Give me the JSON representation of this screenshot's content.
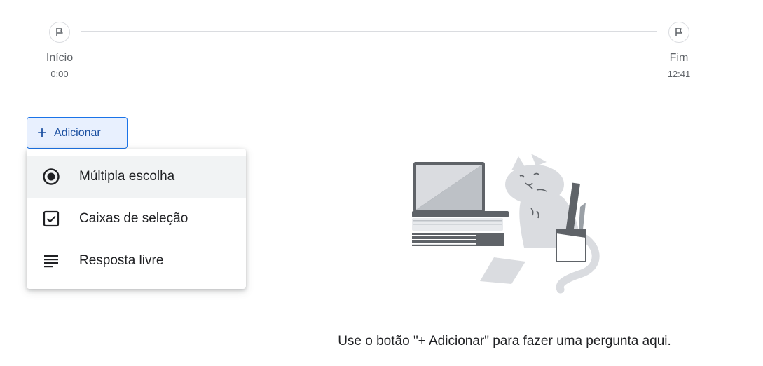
{
  "timeline": {
    "start_label": "Início",
    "start_time": "0:00",
    "end_label": "Fim",
    "end_time": "12:41"
  },
  "add_button": {
    "icon": "plus-icon",
    "label": "Adicionar"
  },
  "menu": {
    "items": [
      {
        "icon": "radio-button-checked-icon",
        "label": "Múltipla escolha"
      },
      {
        "icon": "checkbox-checked-icon",
        "label": "Caixas de seleção"
      },
      {
        "icon": "short-text-icon",
        "label": "Resposta livre"
      }
    ]
  },
  "empty_state": {
    "illustration": "cat-with-laptop-and-books-illustration",
    "hint": "Use o botão \"+ Adicionar\" para fazer uma pergunta aqui."
  },
  "colors": {
    "accent": "#1a73e8",
    "button_bg": "#e8f0fe",
    "menu_hover": "#f1f3f4"
  }
}
